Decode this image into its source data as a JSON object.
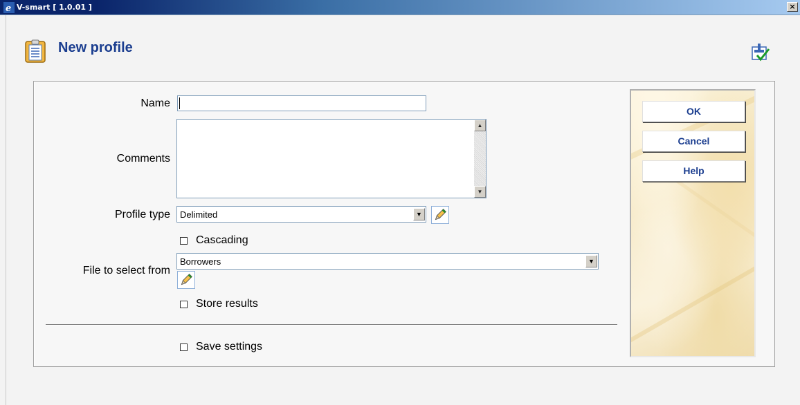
{
  "window": {
    "title": "V-smart [ 1.0.01 ]",
    "close_glyph": "×"
  },
  "header": {
    "title": "New profile",
    "page_icon": "clipboard-icon",
    "favorite_icon": "favorite-checkmark-icon"
  },
  "form": {
    "name_label": "Name",
    "name_value": "",
    "comments_label": "Comments",
    "comments_value": "",
    "profile_type_label": "Profile type",
    "profile_type_value": "Delimited",
    "cascading_label": "Cascading",
    "file_label": "File to select from",
    "file_value": "Borrowers",
    "store_results_label": "Store results",
    "save_settings_label": "Save settings"
  },
  "actions": {
    "ok_label": "OK",
    "cancel_label": "Cancel",
    "help_label": "Help"
  },
  "colors": {
    "title_blue": "#1a3d8f",
    "titlebar_start": "#0a246a",
    "titlebar_end": "#a6caf0"
  }
}
